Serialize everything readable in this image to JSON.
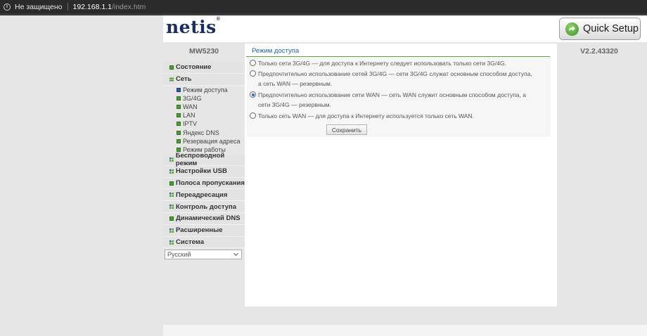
{
  "browser": {
    "security_label": "Не защищено",
    "url_host": "192.168.1.1",
    "url_path": "/index.htm"
  },
  "header": {
    "logo_text": "netis",
    "logo_mark": "®",
    "quick_setup_label": "Quick Setup"
  },
  "device": {
    "model": "MW5230",
    "version": "V2.2.43320"
  },
  "sidebar": {
    "status": "Состояние",
    "network": "Сеть",
    "network_subitems": [
      {
        "label": "Режим доступа",
        "active": true
      },
      {
        "label": "3G/4G"
      },
      {
        "label": "WAN"
      },
      {
        "label": "LAN"
      },
      {
        "label": "IPTV"
      },
      {
        "label": "Яндекс DNS"
      },
      {
        "label": "Резервация адреса"
      },
      {
        "label": "Режим работы"
      }
    ],
    "items": [
      "Беспроводной режим",
      "Настройки USB",
      "Полоса пропускания",
      "Переадресация",
      "Контроль доступа",
      "Динамический DNS",
      "Расширенные",
      "Система"
    ],
    "language": "Русский"
  },
  "main": {
    "title": "Режим доступа",
    "options": [
      {
        "text": "Только сети 3G/4G — для доступа к Интернету следует использовать только сети 3G/4G.",
        "checked": false
      },
      {
        "text": "Предпочтительно использование сетей 3G/4G — сети 3G/4G служат основным способом доступа, а сеть WAN — резервным.",
        "checked": false
      },
      {
        "text": "Предпочтительно использование сети WAN — сеть WAN служит основным способом доступа, а сети 3G/4G — резервным.",
        "checked": true
      },
      {
        "text": "Только сеть WAN — для доступа к Интернету используется только сеть WAN.",
        "checked": false
      }
    ],
    "save_label": "Сохранить"
  },
  "colors": {
    "brand_navy": "#1b2d5f",
    "accent_green": "#5aa43c",
    "title_blue": "#1f5f9a",
    "active_blue": "#2a5aa8"
  },
  "icons": {
    "info": "info-icon",
    "quick_setup": "quick-setup-icon",
    "menu_bullet": "square-bullet-icon",
    "network_open": "list-open-icon",
    "dropdown": "chevron-down-icon"
  }
}
